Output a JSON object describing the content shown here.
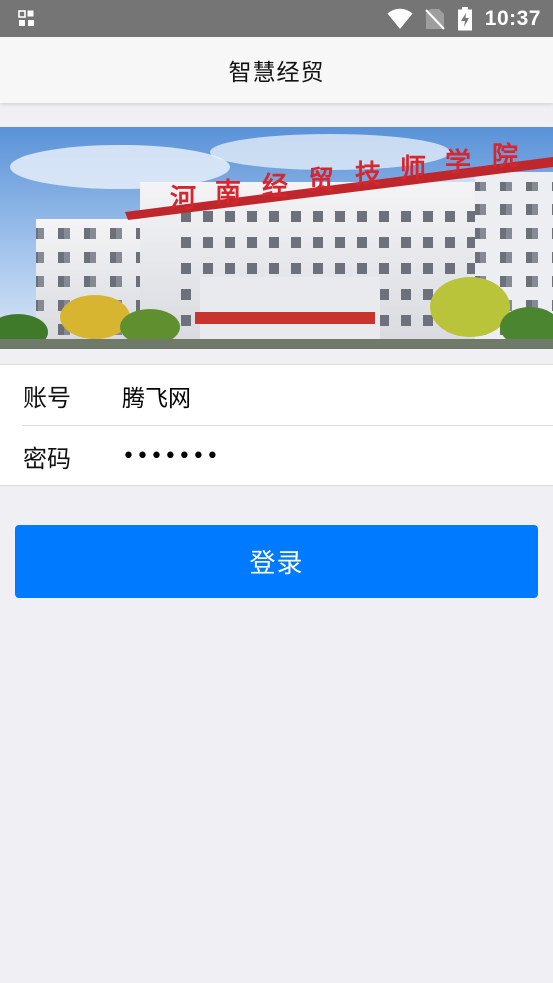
{
  "status_bar": {
    "time": "10:37",
    "icons": [
      "app-grid-icon",
      "wifi-icon",
      "no-sim-icon",
      "battery-charging-icon"
    ]
  },
  "header": {
    "title": "智慧经贸"
  },
  "banner": {
    "sign_text": "河南经贸技师学院",
    "image_description": "campus building"
  },
  "form": {
    "account_label": "账号",
    "account_value": "腾飞网",
    "password_label": "密码",
    "password_value": "•••••••"
  },
  "login_button": {
    "label": "登录"
  },
  "colors": {
    "primary": "#007aff",
    "status_bar": "#757575",
    "background": "#efeff4"
  }
}
